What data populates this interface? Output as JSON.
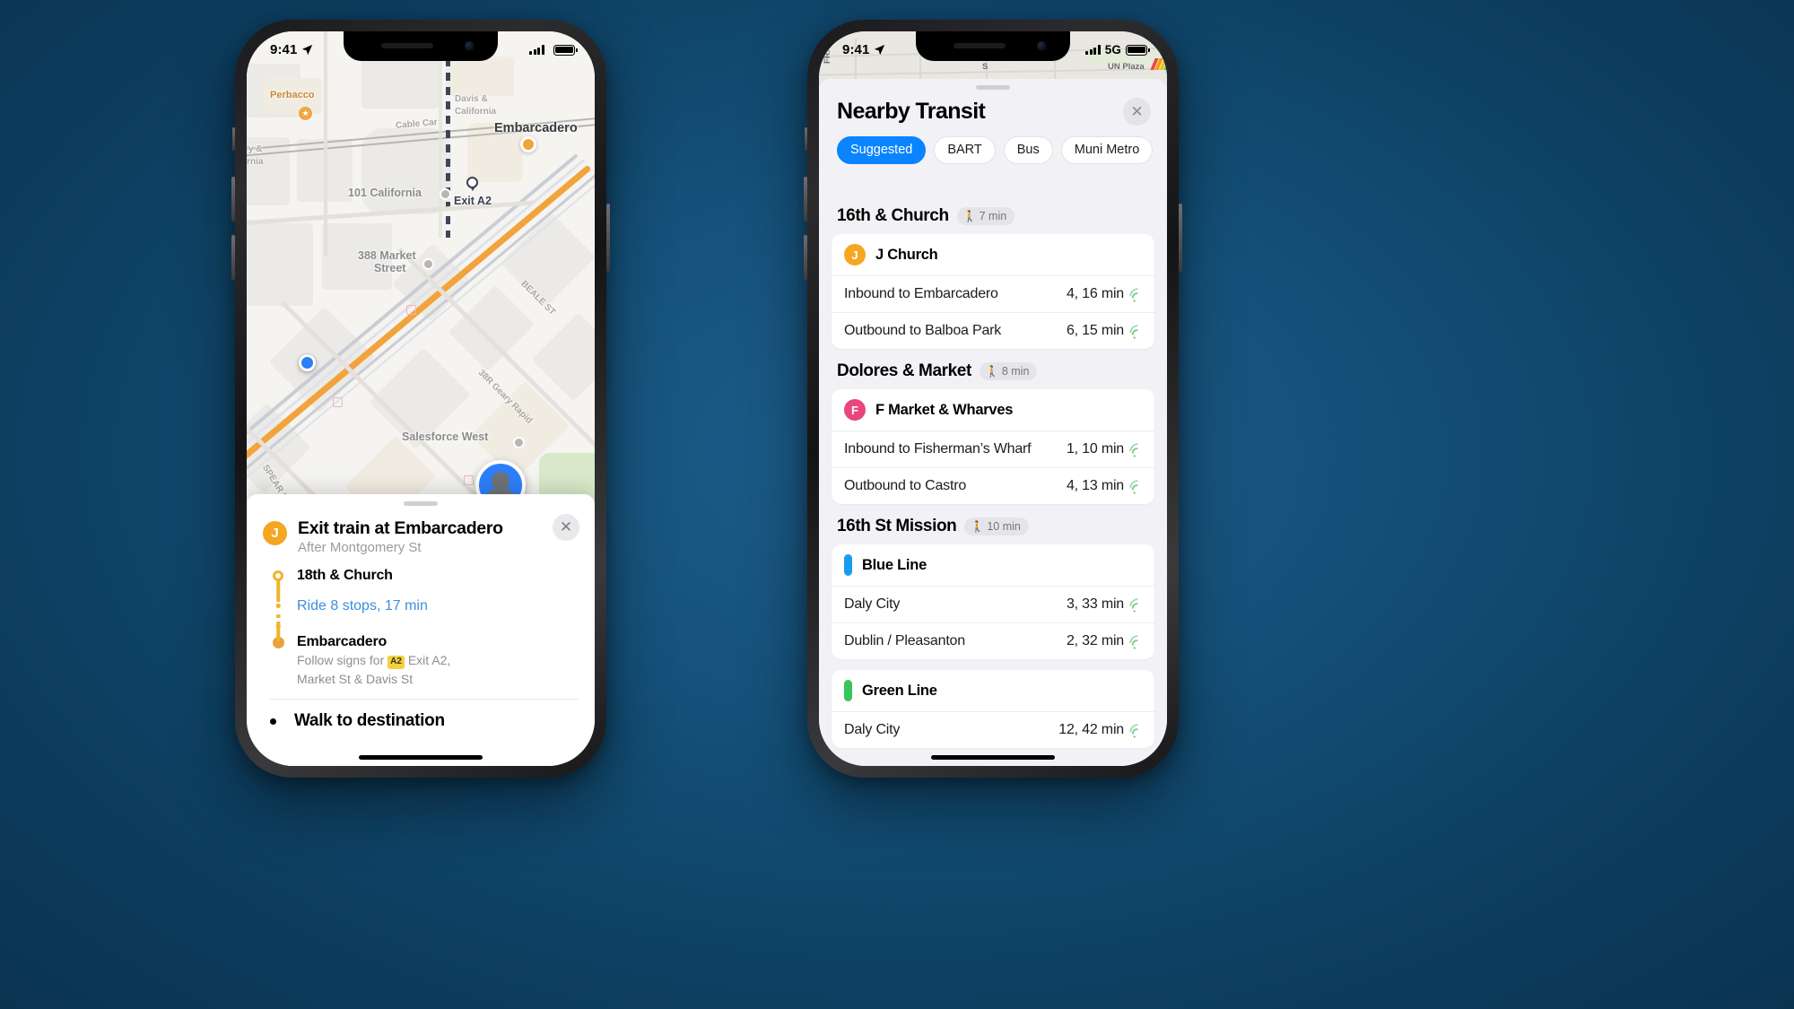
{
  "colors": {
    "accent_blue": "#0a84ff",
    "muni_orange": "#f5a623",
    "f_line_pink": "#e8467c",
    "bart_blue": "#1a9bf0",
    "bart_green": "#35c759",
    "link_blue": "#3b8fe0",
    "sign_yellow": "#f4d03f"
  },
  "left_phone": {
    "status_bar": {
      "time": "9:41",
      "location_icon": "location-arrow-icon",
      "network": "",
      "signal_icon": "signal-bars-icon",
      "battery_icon": "battery-icon"
    },
    "map": {
      "labels": [
        {
          "text": "Perbacco",
          "kind": "poi"
        },
        {
          "text": "Cable Car",
          "kind": "street"
        },
        {
          "text": "Davis &",
          "kind": "street"
        },
        {
          "text": "California",
          "kind": "street"
        },
        {
          "text": "ry &",
          "kind": "street"
        },
        {
          "text": "ornia",
          "kind": "street"
        },
        {
          "text": "101 California",
          "kind": "poi-grey"
        },
        {
          "text": "388 Market",
          "kind": "poi-grey"
        },
        {
          "text": "Street",
          "kind": "poi-grey"
        },
        {
          "text": "Embarcadero",
          "kind": "station"
        },
        {
          "text": "Exit A2",
          "kind": "exit"
        },
        {
          "text": "BEALE ST",
          "kind": "street"
        },
        {
          "text": "38R Geary Rapid",
          "kind": "street"
        },
        {
          "text": "Salesforce West",
          "kind": "poi-grey"
        },
        {
          "text": "SPEAR ST",
          "kind": "street"
        }
      ],
      "user_location": "blue-dot-current-location",
      "destination_marker": "avatar-marker"
    },
    "sheet": {
      "line_badge": "J",
      "title": "Exit train at Embarcadero",
      "subtitle": "After Montgomery St",
      "close_label": "✕",
      "steps": [
        {
          "name": "18th & Church",
          "type": "origin"
        },
        {
          "name": "Ride 8 stops, 17 min",
          "type": "ride"
        },
        {
          "name": "Embarcadero",
          "type": "destination",
          "desc_pre": "Follow signs for ",
          "desc_badge": "A2",
          "desc_post": " Exit A2,",
          "desc_line2": "Market St & Davis St"
        }
      ],
      "next_step": "Walk to destination"
    }
  },
  "right_phone": {
    "status_bar": {
      "time": "9:41",
      "location_icon": "location-arrow-icon",
      "network": "5G",
      "signal_icon": "signal-bars-icon",
      "battery_icon": "battery-icon"
    },
    "map_strip": {
      "labels": [
        "UN Plaza",
        "FR.",
        "S"
      ]
    },
    "header": {
      "title": "Nearby Transit",
      "close_label": "✕"
    },
    "filters": [
      {
        "label": "Suggested",
        "active": true
      },
      {
        "label": "BART",
        "active": false
      },
      {
        "label": "Bus",
        "active": false
      },
      {
        "label": "Muni Metro",
        "active": false
      }
    ],
    "stations": [
      {
        "name": "16th & Church",
        "walk_time": "7 min",
        "routes": [
          {
            "badge": "J",
            "badge_type": "circle",
            "badge_color": "#f5a623",
            "name": "J Church",
            "departures": [
              {
                "destination": "Inbound to Embarcadero",
                "times": "4, 16 min",
                "live": true
              },
              {
                "destination": "Outbound to Balboa Park",
                "times": "6, 15 min",
                "live": true
              }
            ]
          }
        ]
      },
      {
        "name": "Dolores & Market",
        "walk_time": "8 min",
        "routes": [
          {
            "badge": "F",
            "badge_type": "circle",
            "badge_color": "#e8467c",
            "name": "F Market & Wharves",
            "departures": [
              {
                "destination": "Inbound to Fisherman’s Wharf",
                "times": "1, 10 min",
                "live": true
              },
              {
                "destination": "Outbound to Castro",
                "times": "4, 13 min",
                "live": true
              }
            ]
          }
        ]
      },
      {
        "name": "16th St Mission",
        "walk_time": "10 min",
        "routes": [
          {
            "badge": "",
            "badge_type": "bar",
            "badge_color": "#1a9bf0",
            "name": "Blue Line",
            "departures": [
              {
                "destination": "Daly City",
                "times": "3, 33 min",
                "live": true
              },
              {
                "destination": "Dublin / Pleasanton",
                "times": "2, 32 min",
                "live": true
              }
            ]
          },
          {
            "badge": "",
            "badge_type": "bar",
            "badge_color": "#35c759",
            "name": "Green Line",
            "departures": [
              {
                "destination": "Daly City",
                "times": "12, 42 min",
                "live": true
              }
            ]
          }
        ]
      }
    ]
  }
}
